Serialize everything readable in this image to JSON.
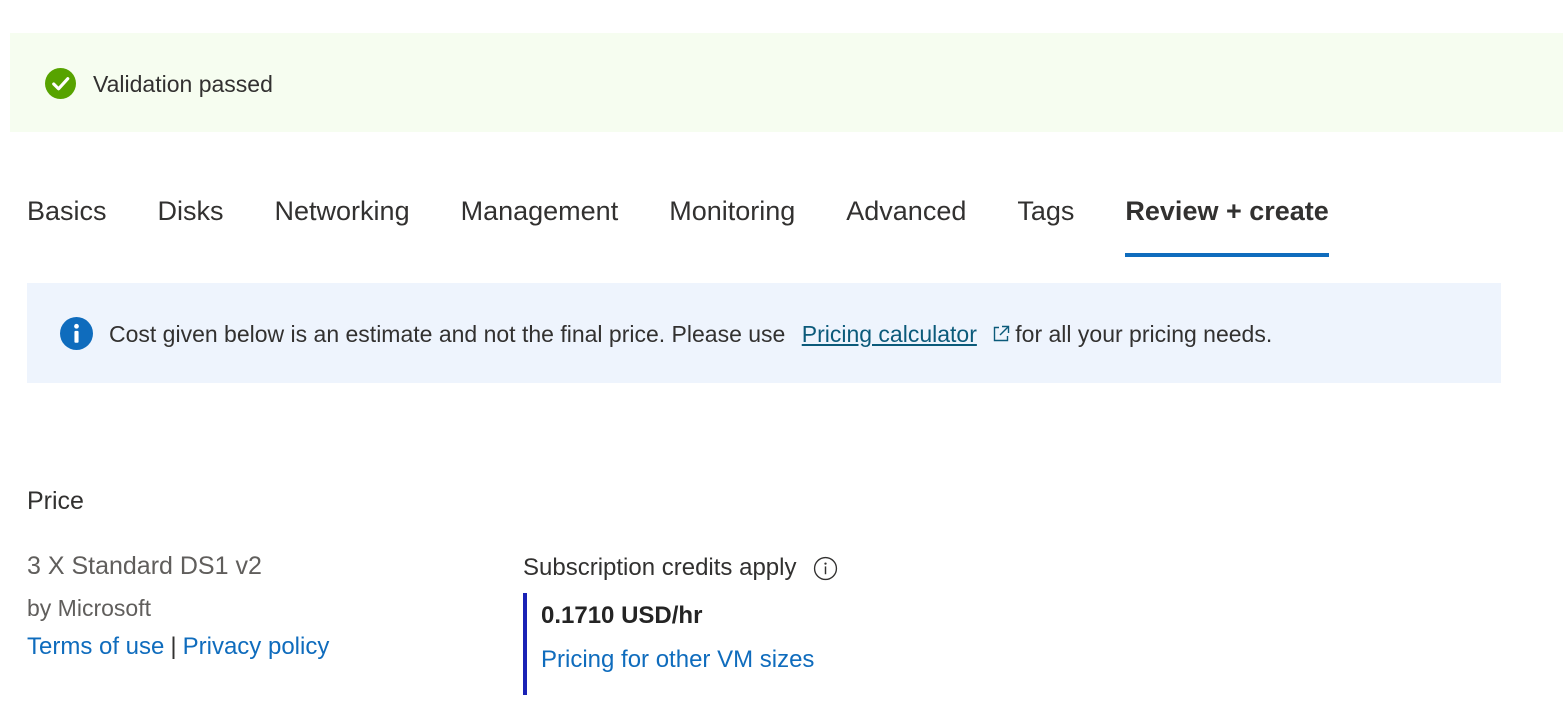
{
  "validation": {
    "message": "Validation passed",
    "status_color": "#57a300",
    "icon": "checkmark-circle-icon"
  },
  "tabs": [
    {
      "label": "Basics",
      "active": false
    },
    {
      "label": "Disks",
      "active": false
    },
    {
      "label": "Networking",
      "active": false
    },
    {
      "label": "Management",
      "active": false
    },
    {
      "label": "Monitoring",
      "active": false
    },
    {
      "label": "Advanced",
      "active": false
    },
    {
      "label": "Tags",
      "active": false
    },
    {
      "label": "Review + create",
      "active": true
    }
  ],
  "info_banner": {
    "text_before": "Cost given below is an estimate and not the final price. Please use",
    "link_label": "Pricing calculator",
    "text_after": "for all your pricing needs.",
    "icon": "info-icon",
    "accent_color": "#0f6cbd"
  },
  "price": {
    "heading": "Price",
    "product_name": "3 X Standard DS1 v2",
    "publisher": "by Microsoft",
    "terms_label": "Terms of use",
    "separator": "|",
    "privacy_label": "Privacy policy",
    "credits_label": "Subscription credits apply",
    "hourly_price": "0.1710 USD/hr",
    "other_sizes_label": "Pricing for other VM sizes"
  }
}
